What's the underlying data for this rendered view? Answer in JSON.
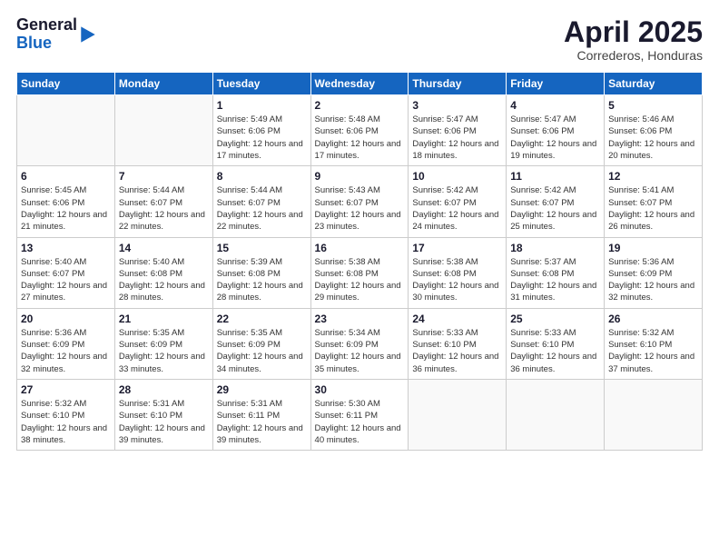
{
  "header": {
    "logo": {
      "general": "General",
      "blue": "Blue"
    },
    "title": "April 2025",
    "subtitle": "Correderos, Honduras"
  },
  "weekdays": [
    "Sunday",
    "Monday",
    "Tuesday",
    "Wednesday",
    "Thursday",
    "Friday",
    "Saturday"
  ],
  "weeks": [
    [
      {
        "day": "",
        "info": ""
      },
      {
        "day": "",
        "info": ""
      },
      {
        "day": "1",
        "info": "Sunrise: 5:49 AM\nSunset: 6:06 PM\nDaylight: 12 hours and 17 minutes."
      },
      {
        "day": "2",
        "info": "Sunrise: 5:48 AM\nSunset: 6:06 PM\nDaylight: 12 hours and 17 minutes."
      },
      {
        "day": "3",
        "info": "Sunrise: 5:47 AM\nSunset: 6:06 PM\nDaylight: 12 hours and 18 minutes."
      },
      {
        "day": "4",
        "info": "Sunrise: 5:47 AM\nSunset: 6:06 PM\nDaylight: 12 hours and 19 minutes."
      },
      {
        "day": "5",
        "info": "Sunrise: 5:46 AM\nSunset: 6:06 PM\nDaylight: 12 hours and 20 minutes."
      }
    ],
    [
      {
        "day": "6",
        "info": "Sunrise: 5:45 AM\nSunset: 6:06 PM\nDaylight: 12 hours and 21 minutes."
      },
      {
        "day": "7",
        "info": "Sunrise: 5:44 AM\nSunset: 6:07 PM\nDaylight: 12 hours and 22 minutes."
      },
      {
        "day": "8",
        "info": "Sunrise: 5:44 AM\nSunset: 6:07 PM\nDaylight: 12 hours and 22 minutes."
      },
      {
        "day": "9",
        "info": "Sunrise: 5:43 AM\nSunset: 6:07 PM\nDaylight: 12 hours and 23 minutes."
      },
      {
        "day": "10",
        "info": "Sunrise: 5:42 AM\nSunset: 6:07 PM\nDaylight: 12 hours and 24 minutes."
      },
      {
        "day": "11",
        "info": "Sunrise: 5:42 AM\nSunset: 6:07 PM\nDaylight: 12 hours and 25 minutes."
      },
      {
        "day": "12",
        "info": "Sunrise: 5:41 AM\nSunset: 6:07 PM\nDaylight: 12 hours and 26 minutes."
      }
    ],
    [
      {
        "day": "13",
        "info": "Sunrise: 5:40 AM\nSunset: 6:07 PM\nDaylight: 12 hours and 27 minutes."
      },
      {
        "day": "14",
        "info": "Sunrise: 5:40 AM\nSunset: 6:08 PM\nDaylight: 12 hours and 28 minutes."
      },
      {
        "day": "15",
        "info": "Sunrise: 5:39 AM\nSunset: 6:08 PM\nDaylight: 12 hours and 28 minutes."
      },
      {
        "day": "16",
        "info": "Sunrise: 5:38 AM\nSunset: 6:08 PM\nDaylight: 12 hours and 29 minutes."
      },
      {
        "day": "17",
        "info": "Sunrise: 5:38 AM\nSunset: 6:08 PM\nDaylight: 12 hours and 30 minutes."
      },
      {
        "day": "18",
        "info": "Sunrise: 5:37 AM\nSunset: 6:08 PM\nDaylight: 12 hours and 31 minutes."
      },
      {
        "day": "19",
        "info": "Sunrise: 5:36 AM\nSunset: 6:09 PM\nDaylight: 12 hours and 32 minutes."
      }
    ],
    [
      {
        "day": "20",
        "info": "Sunrise: 5:36 AM\nSunset: 6:09 PM\nDaylight: 12 hours and 32 minutes."
      },
      {
        "day": "21",
        "info": "Sunrise: 5:35 AM\nSunset: 6:09 PM\nDaylight: 12 hours and 33 minutes."
      },
      {
        "day": "22",
        "info": "Sunrise: 5:35 AM\nSunset: 6:09 PM\nDaylight: 12 hours and 34 minutes."
      },
      {
        "day": "23",
        "info": "Sunrise: 5:34 AM\nSunset: 6:09 PM\nDaylight: 12 hours and 35 minutes."
      },
      {
        "day": "24",
        "info": "Sunrise: 5:33 AM\nSunset: 6:10 PM\nDaylight: 12 hours and 36 minutes."
      },
      {
        "day": "25",
        "info": "Sunrise: 5:33 AM\nSunset: 6:10 PM\nDaylight: 12 hours and 36 minutes."
      },
      {
        "day": "26",
        "info": "Sunrise: 5:32 AM\nSunset: 6:10 PM\nDaylight: 12 hours and 37 minutes."
      }
    ],
    [
      {
        "day": "27",
        "info": "Sunrise: 5:32 AM\nSunset: 6:10 PM\nDaylight: 12 hours and 38 minutes."
      },
      {
        "day": "28",
        "info": "Sunrise: 5:31 AM\nSunset: 6:10 PM\nDaylight: 12 hours and 39 minutes."
      },
      {
        "day": "29",
        "info": "Sunrise: 5:31 AM\nSunset: 6:11 PM\nDaylight: 12 hours and 39 minutes."
      },
      {
        "day": "30",
        "info": "Sunrise: 5:30 AM\nSunset: 6:11 PM\nDaylight: 12 hours and 40 minutes."
      },
      {
        "day": "",
        "info": ""
      },
      {
        "day": "",
        "info": ""
      },
      {
        "day": "",
        "info": ""
      }
    ]
  ]
}
